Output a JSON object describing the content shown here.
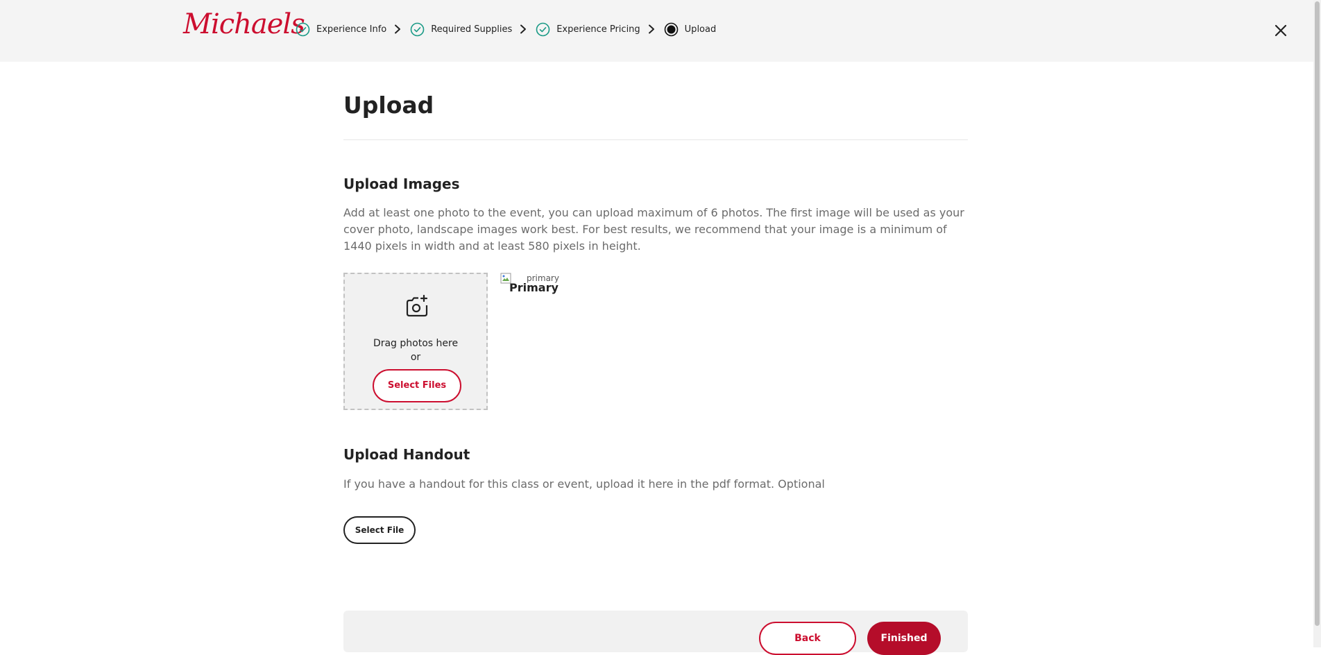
{
  "header": {
    "logo_text": "Michaels",
    "steps": [
      {
        "label": "Experience Info",
        "status": "complete"
      },
      {
        "label": "Required Supplies",
        "status": "complete"
      },
      {
        "label": "Experience Pricing",
        "status": "complete"
      },
      {
        "label": "Upload",
        "status": "current"
      }
    ],
    "close_icon": "close-icon"
  },
  "page": {
    "title": "Upload"
  },
  "upload_images": {
    "title": "Upload Images",
    "description": "Add at least one photo to the event, you can upload maximum of 6 photos. The first image will be used as your cover photo, landscape images work best. For best results, we recommend that your image is a minimum of 1440 pixels in width and at least 580 pixels in height.",
    "dropzone": {
      "icon": "camera-plus-icon",
      "drag_text": "Drag photos here",
      "or_text": "or",
      "button_label": "Select Files"
    },
    "thumbnail": {
      "alt_text": "primary",
      "badge": "Primary"
    }
  },
  "upload_handout": {
    "title": "Upload Handout",
    "description": "If you have a handout for this class or event, upload it here in the pdf format. Optional",
    "button_label": "Select File"
  },
  "footer": {
    "back_label": "Back",
    "finished_label": "Finished"
  },
  "colors": {
    "brand_red": "#cc0e2f",
    "finished_bg": "#b50d2a",
    "step_complete": "#1a9a86",
    "header_bg": "#f4f4f4"
  }
}
